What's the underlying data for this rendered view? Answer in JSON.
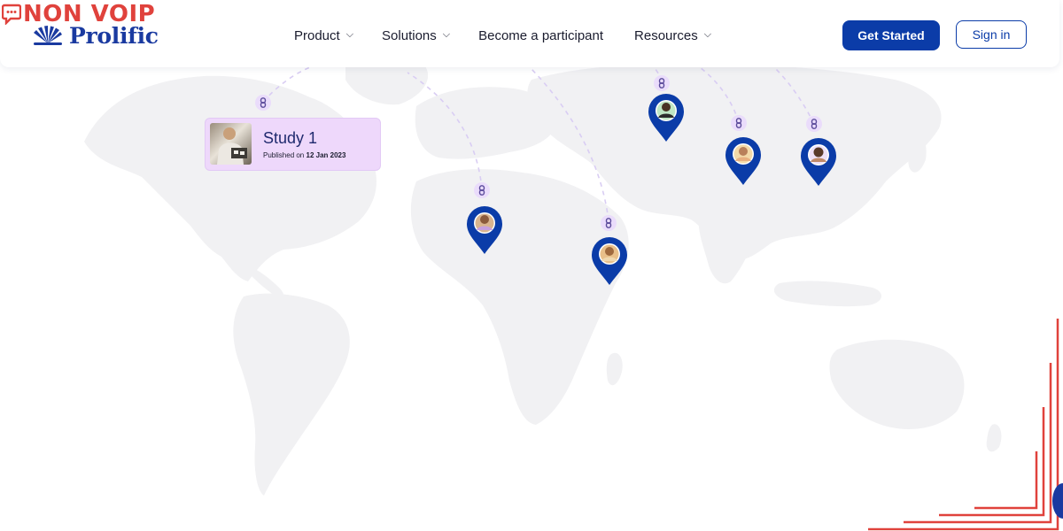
{
  "watermark": {
    "text": "NON VOIP",
    "color": "#e0423c"
  },
  "brand": {
    "name": "Prolific",
    "logo_icon": "prolific-fan-logo",
    "color": "#1a3aa0"
  },
  "nav": {
    "items": [
      {
        "label": "Product",
        "has_dropdown": true
      },
      {
        "label": "Solutions",
        "has_dropdown": true
      },
      {
        "label": "Become a participant",
        "has_dropdown": false
      },
      {
        "label": "Resources",
        "has_dropdown": true
      }
    ],
    "dropdown_icon": "chevron-down-icon"
  },
  "actions": {
    "get_started": "Get Started",
    "sign_in": "Sign in",
    "accent_color": "#0b3ca8"
  },
  "study_card": {
    "title": "Study 1",
    "published_prefix": "Published on",
    "published_date": "12 Jan 2023",
    "background_color": "#eed8fb"
  },
  "map": {
    "marker_color": "#0b3ca8",
    "link_badge_color": "#eadcfb",
    "land_color": "#f1f1f3",
    "markers": [
      {
        "name": "west-africa",
        "link_icon": "link-icon"
      },
      {
        "name": "east-africa",
        "link_icon": "link-icon"
      },
      {
        "name": "central-asia",
        "link_icon": "link-icon"
      },
      {
        "name": "south-asia",
        "link_icon": "link-icon"
      },
      {
        "name": "east-asia",
        "link_icon": "link-icon"
      }
    ]
  }
}
